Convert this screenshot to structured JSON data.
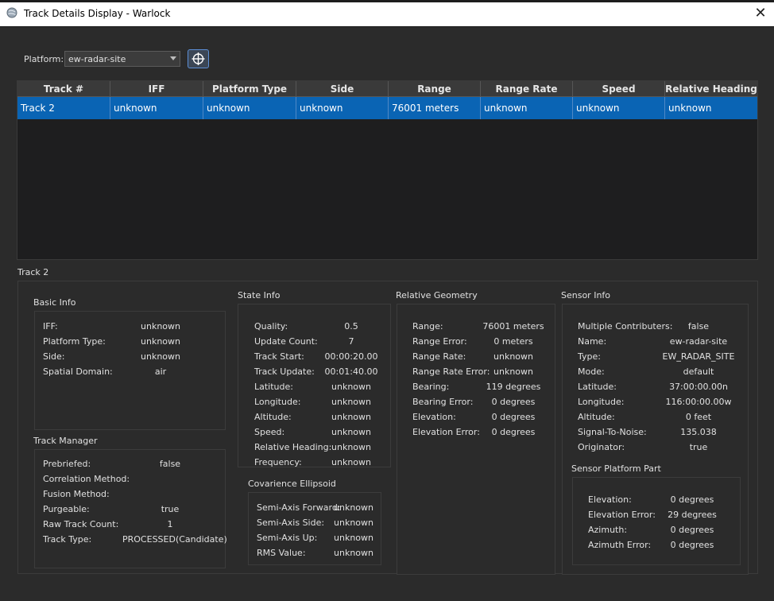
{
  "window": {
    "title": "Track Details Display - Warlock",
    "close_glyph": "✕"
  },
  "platform": {
    "label": "Platform:",
    "value": "ew-radar-site"
  },
  "table": {
    "columns": [
      "Track #",
      "IFF",
      "Platform Type",
      "Side",
      "Range",
      "Range Rate",
      "Speed",
      "Relative Heading"
    ],
    "rows": [
      [
        "Track 2",
        "unknown",
        "unknown",
        "unknown",
        "76001 meters",
        "unknown",
        "unknown",
        "unknown"
      ]
    ]
  },
  "details": {
    "selected_track": "Track 2",
    "basic_info": {
      "title": "Basic Info",
      "fields": [
        {
          "label": "IFF:",
          "value": "unknown"
        },
        {
          "label": "Platform Type:",
          "value": "unknown"
        },
        {
          "label": "Side:",
          "value": "unknown"
        },
        {
          "label": "Spatial Domain:",
          "value": "air"
        }
      ]
    },
    "track_manager": {
      "title": "Track Manager",
      "fields": [
        {
          "label": "Prebriefed:",
          "value": "false"
        },
        {
          "label": "Correlation Method:",
          "value": ""
        },
        {
          "label": "Fusion Method:",
          "value": ""
        },
        {
          "label": "Purgeable:",
          "value": "true"
        },
        {
          "label": "Raw Track Count:",
          "value": "1"
        },
        {
          "label": "Track Type:",
          "value": "PROCESSED(Candidate)"
        }
      ]
    },
    "state_info": {
      "title": "State Info",
      "fields": [
        {
          "label": "Quality:",
          "value": "0.5"
        },
        {
          "label": "Update Count:",
          "value": "7"
        },
        {
          "label": "Track Start:",
          "value": "00:00:20.00"
        },
        {
          "label": "Track Update:",
          "value": "00:01:40.00"
        },
        {
          "label": "Latitude:",
          "value": "unknown"
        },
        {
          "label": "Longitude:",
          "value": "unknown"
        },
        {
          "label": "Altitude:",
          "value": "unknown"
        },
        {
          "label": "Speed:",
          "value": "unknown"
        },
        {
          "label": "Relative Heading:",
          "value": "unknown"
        },
        {
          "label": "Frequency:",
          "value": "unknown"
        }
      ]
    },
    "covariance": {
      "title": "Covarience Ellipsoid",
      "fields": [
        {
          "label": "Semi-Axis Forward:",
          "value": "unknown"
        },
        {
          "label": "Semi-Axis Side:",
          "value": "unknown"
        },
        {
          "label": "Semi-Axis Up:",
          "value": "unknown"
        },
        {
          "label": "RMS Value:",
          "value": "unknown"
        }
      ]
    },
    "relative_geometry": {
      "title": "Relative Geometry",
      "fields": [
        {
          "label": "Range:",
          "value": "76001 meters"
        },
        {
          "label": "Range Error:",
          "value": "0 meters"
        },
        {
          "label": "Range Rate:",
          "value": "unknown"
        },
        {
          "label": "Range Rate Error:",
          "value": "unknown"
        },
        {
          "label": "Bearing:",
          "value": "119 degrees"
        },
        {
          "label": "Bearing Error:",
          "value": "0 degrees"
        },
        {
          "label": "Elevation:",
          "value": "0 degrees"
        },
        {
          "label": "Elevation Error:",
          "value": "0 degrees"
        }
      ]
    },
    "sensor_info": {
      "title": "Sensor Info",
      "fields": [
        {
          "label": "Multiple Contributers:",
          "value": "false"
        },
        {
          "label": "Name:",
          "value": "ew-radar-site"
        },
        {
          "label": "Type:",
          "value": "EW_RADAR_SITE"
        },
        {
          "label": "Mode:",
          "value": "default"
        },
        {
          "label": "Latitude:",
          "value": "37:00:00.00n"
        },
        {
          "label": "Longitude:",
          "value": "116:00:00.00w"
        },
        {
          "label": "Altitude:",
          "value": "0 feet"
        },
        {
          "label": "Signal-To-Noise:",
          "value": "135.038"
        },
        {
          "label": "Originator:",
          "value": "true"
        }
      ]
    },
    "sensor_platform_part": {
      "title": "Sensor Platform Part",
      "fields": [
        {
          "label": "Elevation:",
          "value": "0 degrees"
        },
        {
          "label": "Elevation Error:",
          "value": "29 degrees"
        },
        {
          "label": "Azimuth:",
          "value": "0 degrees"
        },
        {
          "label": "Azimuth Error:",
          "value": "0 degrees"
        }
      ]
    }
  },
  "colors": {
    "selection": "#0a64b4",
    "background": "#2b2b2b",
    "table_bg": "#1e1e1f"
  },
  "icons": {
    "app": "app-globe-icon",
    "target": "crosshair-icon",
    "dropdown": "chevron-down-icon"
  }
}
